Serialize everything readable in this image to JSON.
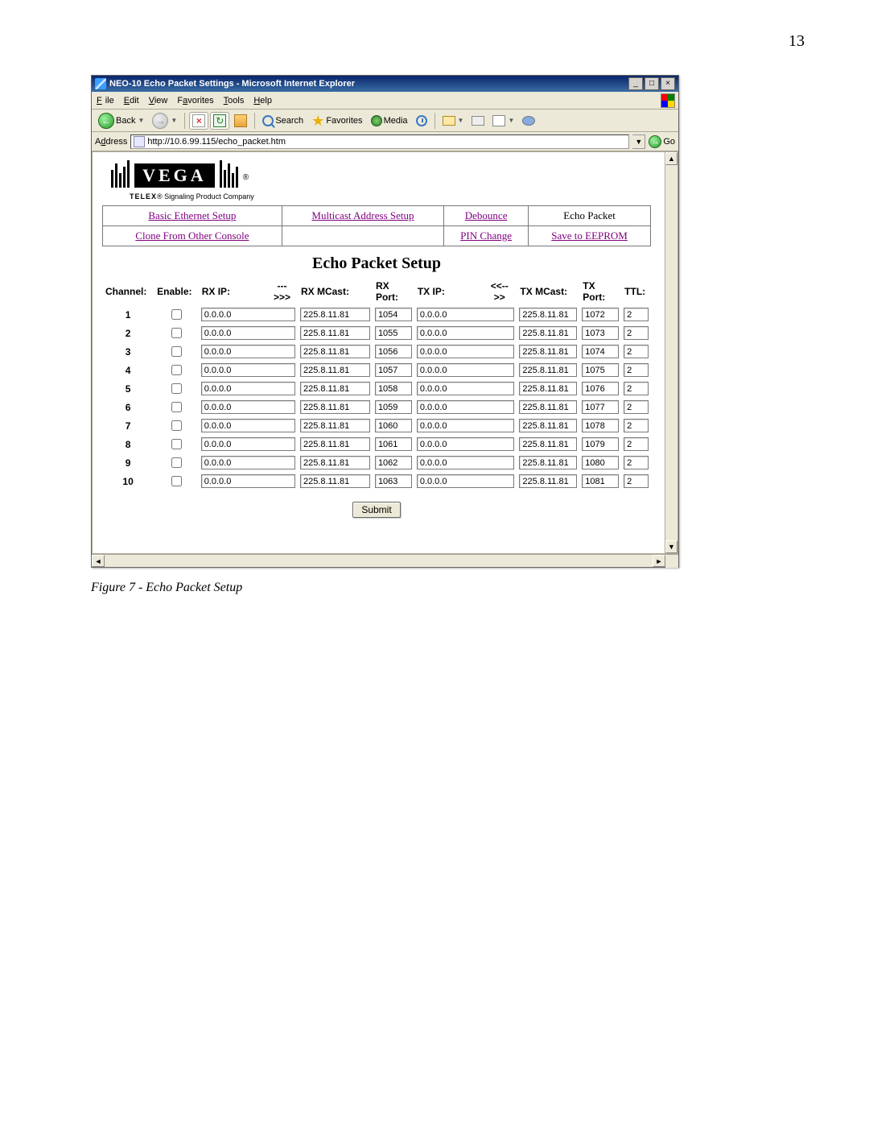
{
  "page_number": "13",
  "browser": {
    "title": "NEO-10 Echo Packet Settings - Microsoft Internet Explorer",
    "menus": {
      "file": "File",
      "edit": "Edit",
      "view": "View",
      "favorites": "Favorites",
      "tools": "Tools",
      "help": "Help"
    },
    "toolbar": {
      "back": "Back",
      "search": "Search",
      "favorites": "Favorites",
      "media": "Media"
    },
    "address_label": "Address",
    "url": "http://10.6.99.115/echo_packet.htm",
    "go": "Go"
  },
  "logo": {
    "brand": "VEGA",
    "sub_bold": "TELEX",
    "sub_rest": "® Signaling Product Company"
  },
  "nav": {
    "r1c1": "Basic Ethernet Setup",
    "r1c2": "Multicast Address Setup",
    "r1c3": "Debounce",
    "r1c4": "Echo Packet",
    "r2c1": "Clone From Other Console",
    "r2c2": "",
    "r2c3": "PIN Change",
    "r2c4": "Save to EEPROM"
  },
  "heading": "Echo Packet Setup",
  "headers": {
    "channel": "Channel:",
    "enable": "Enable:",
    "rxip": "RX IP:",
    "arrow_r": "--->>>",
    "rxmc": "RX MCast:",
    "rxport": "RX Port:",
    "txip": "TX IP:",
    "arrow_b": "<<-->>",
    "txmc": "TX MCast:",
    "txport": "TX Port:",
    "ttl": "TTL:"
  },
  "rows": [
    {
      "ch": "1",
      "rxip": "0.0.0.0",
      "rxmc": "225.8.11.81",
      "rxport": "1054",
      "txip": "0.0.0.0",
      "txmc": "225.8.11.81",
      "txport": "1072",
      "ttl": "2"
    },
    {
      "ch": "2",
      "rxip": "0.0.0.0",
      "rxmc": "225.8.11.81",
      "rxport": "1055",
      "txip": "0.0.0.0",
      "txmc": "225.8.11.81",
      "txport": "1073",
      "ttl": "2"
    },
    {
      "ch": "3",
      "rxip": "0.0.0.0",
      "rxmc": "225.8.11.81",
      "rxport": "1056",
      "txip": "0.0.0.0",
      "txmc": "225.8.11.81",
      "txport": "1074",
      "ttl": "2"
    },
    {
      "ch": "4",
      "rxip": "0.0.0.0",
      "rxmc": "225.8.11.81",
      "rxport": "1057",
      "txip": "0.0.0.0",
      "txmc": "225.8.11.81",
      "txport": "1075",
      "ttl": "2"
    },
    {
      "ch": "5",
      "rxip": "0.0.0.0",
      "rxmc": "225.8.11.81",
      "rxport": "1058",
      "txip": "0.0.0.0",
      "txmc": "225.8.11.81",
      "txport": "1076",
      "ttl": "2"
    },
    {
      "ch": "6",
      "rxip": "0.0.0.0",
      "rxmc": "225.8.11.81",
      "rxport": "1059",
      "txip": "0.0.0.0",
      "txmc": "225.8.11.81",
      "txport": "1077",
      "ttl": "2"
    },
    {
      "ch": "7",
      "rxip": "0.0.0.0",
      "rxmc": "225.8.11.81",
      "rxport": "1060",
      "txip": "0.0.0.0",
      "txmc": "225.8.11.81",
      "txport": "1078",
      "ttl": "2"
    },
    {
      "ch": "8",
      "rxip": "0.0.0.0",
      "rxmc": "225.8.11.81",
      "rxport": "1061",
      "txip": "0.0.0.0",
      "txmc": "225.8.11.81",
      "txport": "1079",
      "ttl": "2"
    },
    {
      "ch": "9",
      "rxip": "0.0.0.0",
      "rxmc": "225.8.11.81",
      "rxport": "1062",
      "txip": "0.0.0.0",
      "txmc": "225.8.11.81",
      "txport": "1080",
      "ttl": "2"
    },
    {
      "ch": "10",
      "rxip": "0.0.0.0",
      "rxmc": "225.8.11.81",
      "rxport": "1063",
      "txip": "0.0.0.0",
      "txmc": "225.8.11.81",
      "txport": "1081",
      "ttl": "2"
    }
  ],
  "submit": "Submit",
  "caption": "Figure 7 - Echo Packet Setup"
}
